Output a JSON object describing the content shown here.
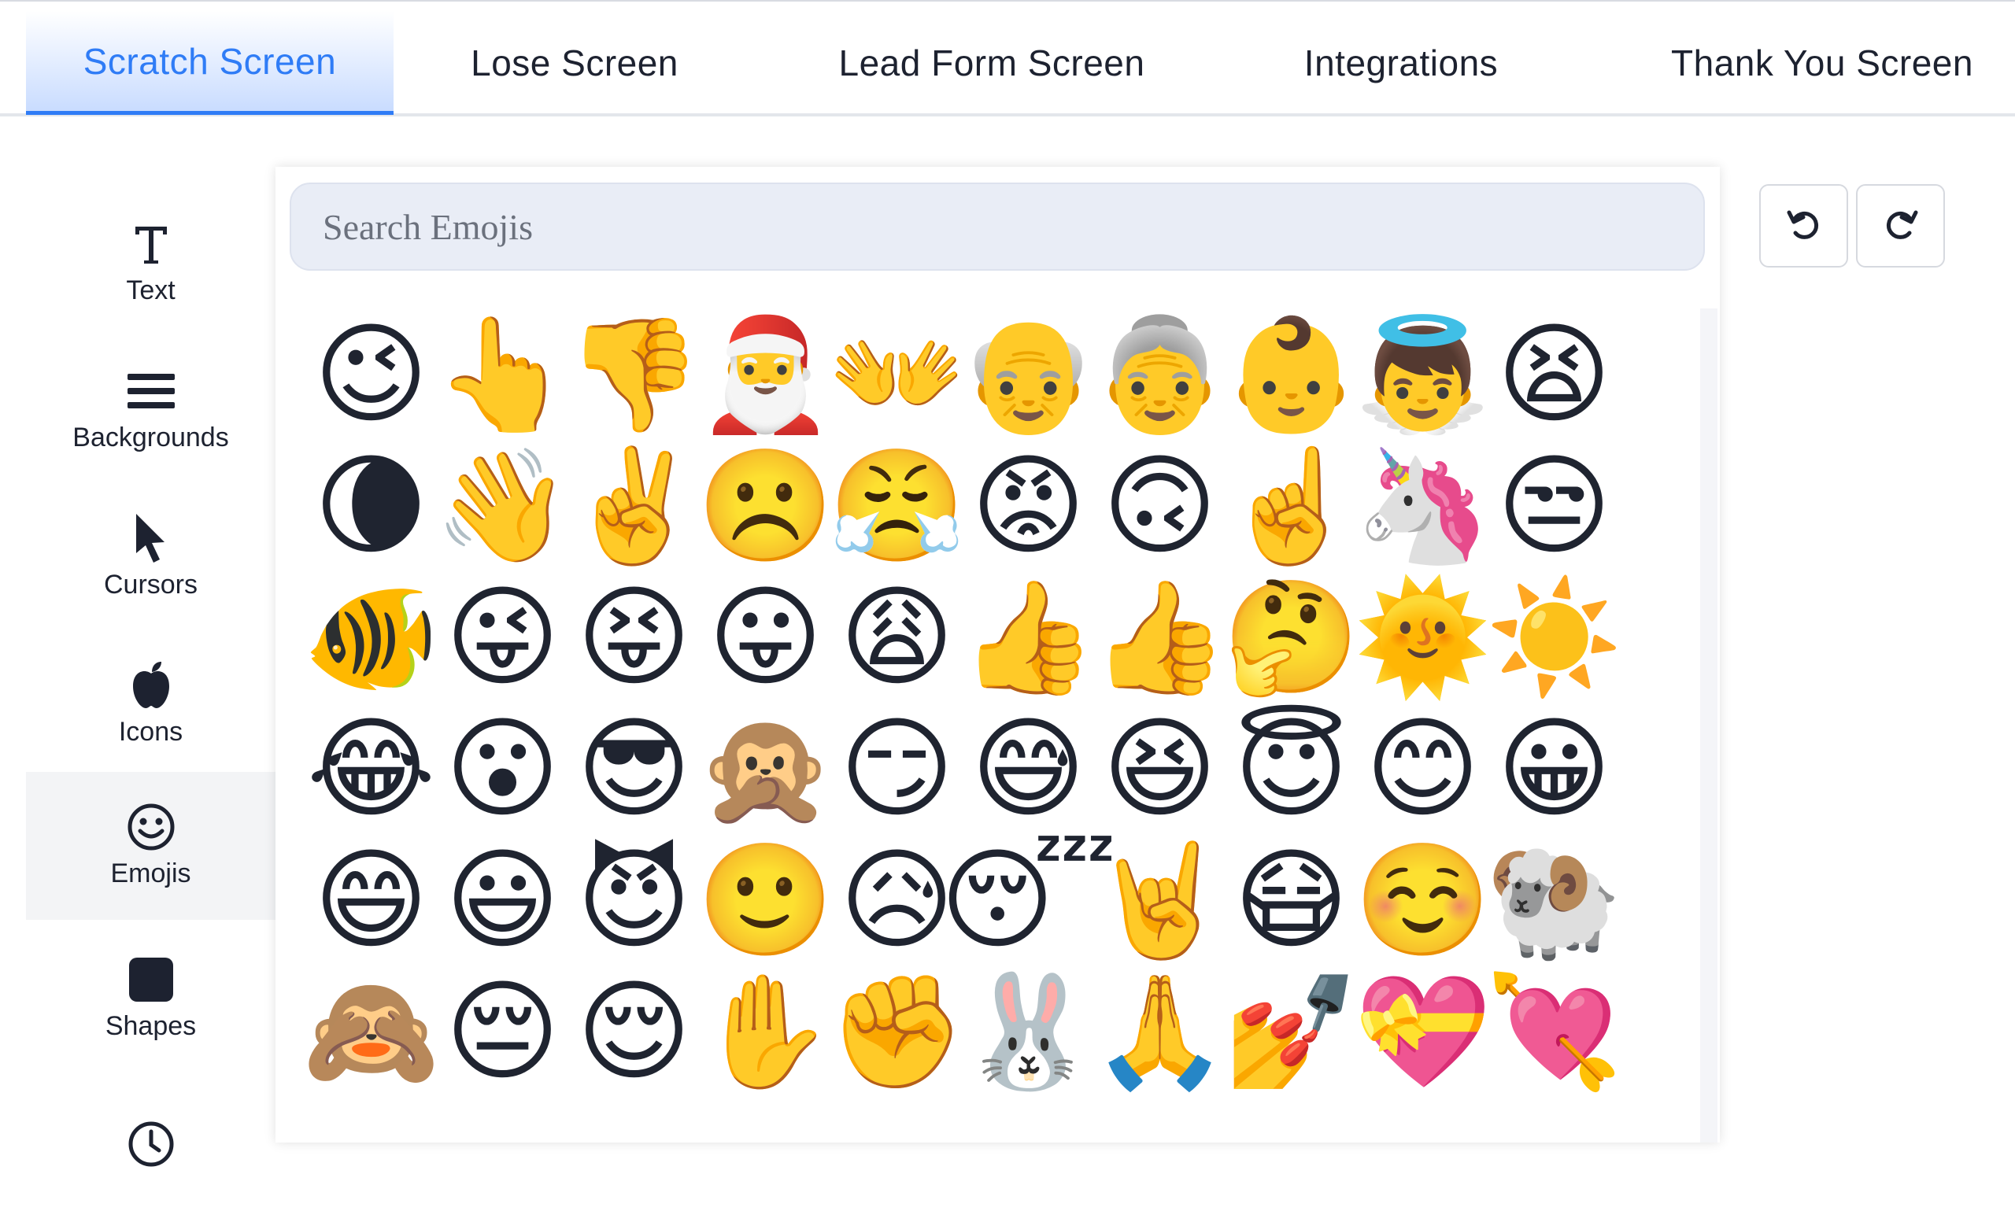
{
  "tabs": [
    {
      "label": "Scratch Screen",
      "active": true
    },
    {
      "label": "Lose Screen",
      "active": false
    },
    {
      "label": "Lead Form Screen",
      "active": false
    },
    {
      "label": "Integrations",
      "active": false
    },
    {
      "label": "Thank You Screen",
      "active": false
    }
  ],
  "sidebar": {
    "items": [
      {
        "label": "Text",
        "icon": "text-icon"
      },
      {
        "label": "Backgrounds",
        "icon": "menu-lines-icon"
      },
      {
        "label": "Cursors",
        "icon": "cursor-icon"
      },
      {
        "label": "Icons",
        "icon": "apple-icon"
      },
      {
        "label": "Emojis",
        "icon": "smiley-icon",
        "active": true
      },
      {
        "label": "Shapes",
        "icon": "square-icon"
      },
      {
        "label": "",
        "icon": "clock-icon"
      }
    ]
  },
  "search": {
    "placeholder": "Search Emojis",
    "value": ""
  },
  "toolbar": {
    "undo_icon": "undo-icon",
    "redo_icon": "redo-icon"
  },
  "emojis": [
    "😉",
    "👆",
    "👎",
    "🎅",
    "👐",
    "👴",
    "👵",
    "👶",
    "👼",
    "😫",
    "🌘",
    "👋",
    "✌️",
    "☹️",
    "😤",
    "😡",
    "🙃",
    "☝️",
    "🦄",
    "😒",
    "🐠",
    "😜",
    "😝",
    "😛",
    "😩",
    "👍",
    "👍",
    "🤔",
    "🌞",
    "☀️",
    "😂",
    "😮",
    "😎",
    "🙊",
    "😏",
    "😅",
    "😆",
    "😇",
    "😊",
    "😀",
    "😄",
    "😃",
    "😈",
    "🙂",
    "😥",
    "😴",
    "🤘",
    "😷",
    "☺️",
    "🐏",
    "🙈",
    "😔",
    "😌",
    "✋",
    "✊",
    "🐰",
    "🙏",
    "💅",
    "💝",
    "💘"
  ],
  "colors": {
    "accent": "#2f7cf6",
    "tab_active_bg": "#c9dcff",
    "search_bg": "#e9edf6"
  }
}
